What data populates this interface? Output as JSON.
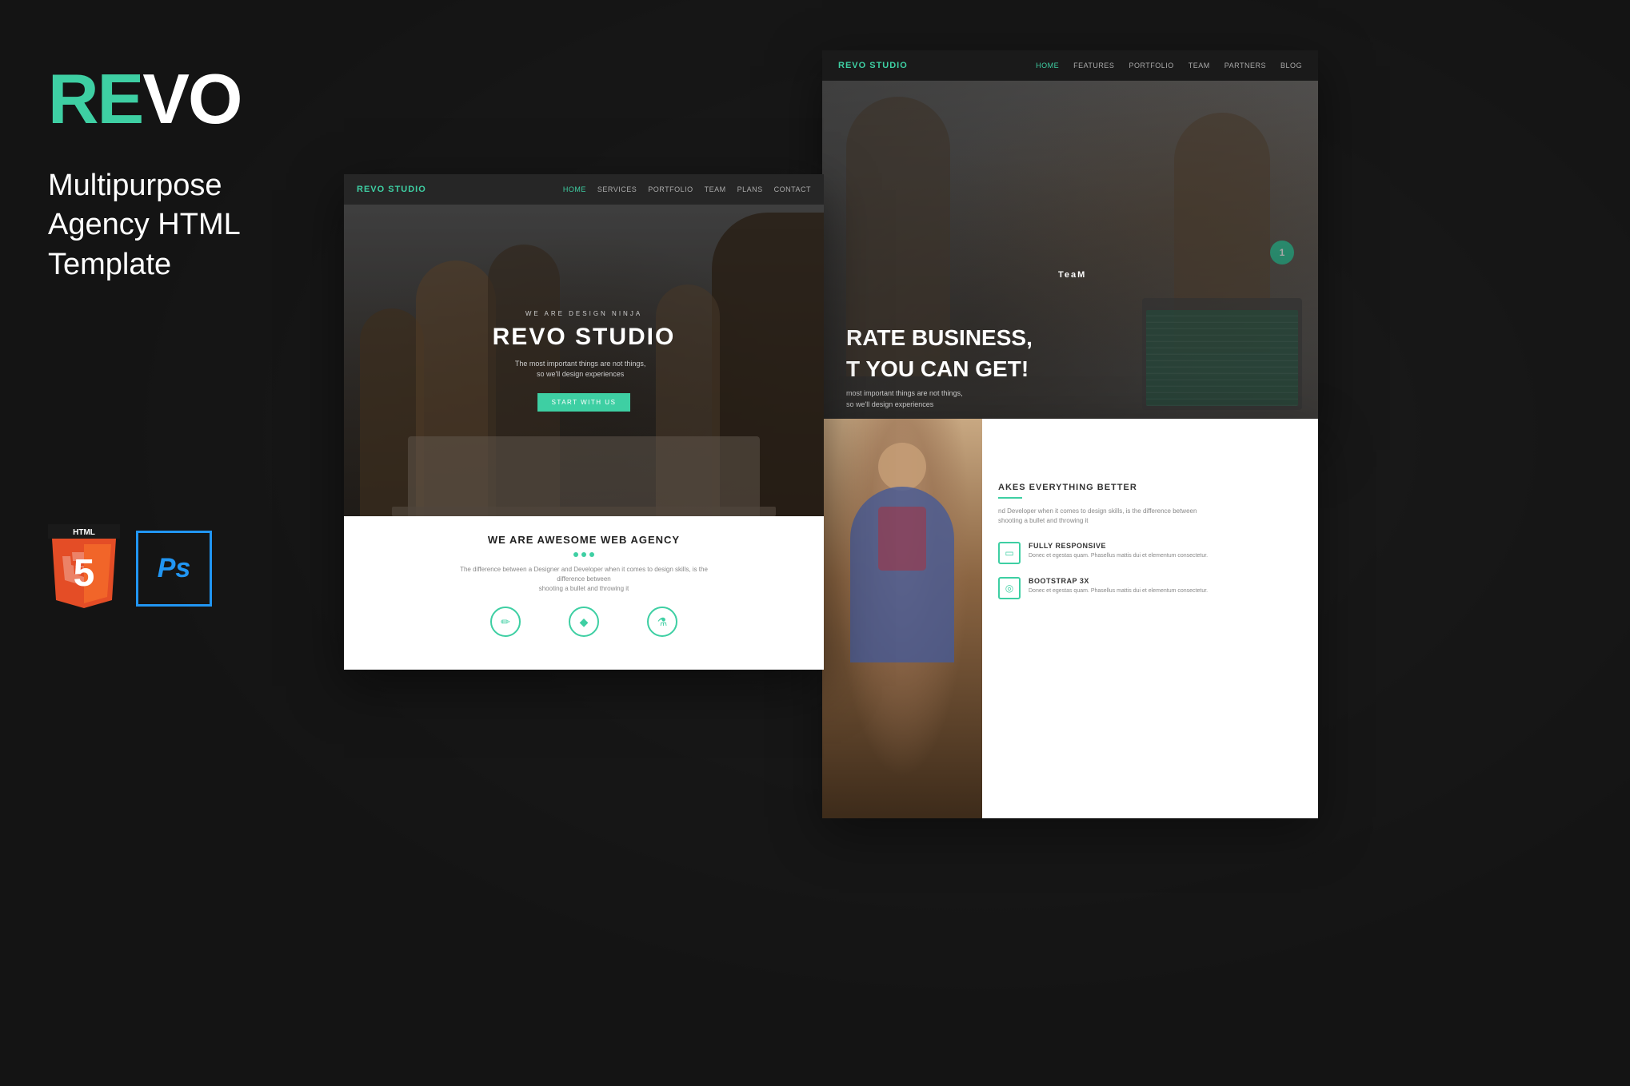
{
  "background": {
    "color": "#1a1a1a"
  },
  "left_panel": {
    "logo": {
      "re": "RE",
      "vo": "VO"
    },
    "tagline_line1": "Multipurpose",
    "tagline_line2": "Agency HTML",
    "tagline_line3": "Template",
    "html5_label": "HTML",
    "html5_version": "5",
    "ps_label": "Ps"
  },
  "preview_left": {
    "nav": {
      "brand_re": "RE",
      "brand_vo": "VO STUDIO",
      "links": [
        "HOME",
        "SERVICES",
        "PORTFOLIO",
        "TEAM",
        "PLANS",
        "CONTACT"
      ],
      "active_link": "HOME"
    },
    "hero": {
      "subtitle": "WE ARE DESIGN NINJA",
      "title": "REVO STUDIO",
      "description": "The most important things are not things,\nso we'll design experiences",
      "cta_button": "START WITH US"
    },
    "bottom": {
      "title": "WE ARE AWESOME WEB AGENCY",
      "description": "The difference between a Designer and Developer when it comes to design skills, is the difference between\nshooting a bullet and throwing it",
      "dots": [
        true,
        true,
        true
      ],
      "icons": [
        "✏",
        "♦",
        "⚗"
      ]
    }
  },
  "preview_right_top": {
    "nav": {
      "brand_re": "RE",
      "brand_vo": "VO STUDIO",
      "links": [
        "HOME",
        "FEATURES",
        "PORTFOLIO",
        "TEAM",
        "PARTNERS",
        "BLOG"
      ],
      "active_link": "HOME"
    },
    "hero": {
      "big_text_line1": "RATE BUSINESS,",
      "big_text_line2": "T YOU CAN GET!",
      "small_text": "most important things are not things,\nso we'll design experiences",
      "badge_number": "1"
    }
  },
  "preview_right_bottom": {
    "section_title": "AKES EVERYTHING BETTER",
    "section_desc": "nd Developer when it comes to design skills, is the difference between\nshooting a bullet and throwing it",
    "features": [
      {
        "icon": "▭",
        "title": "FULLY RESPONSIVE",
        "desc": "Donec et egestas quam. Phasellus mattis dui et elementum consectetur."
      },
      {
        "icon": "◎",
        "title": "BOOTSTRAP 3X",
        "desc": "Donec et egestas quam. Phasellus mattis dui et elementum consectetur."
      }
    ]
  },
  "team_detection": {
    "label": "TeaM"
  },
  "accent_color": "#3ecfa3",
  "dark_color": "#1a1a1a",
  "white": "#ffffff"
}
